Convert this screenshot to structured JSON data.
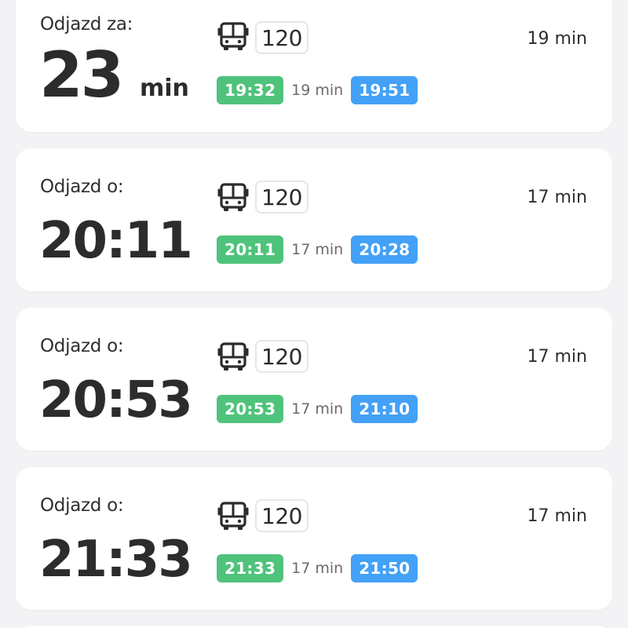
{
  "colors": {
    "departure_chip": "#4fc37b",
    "arrival_chip": "#43a1f7",
    "card_bg": "#ffffff",
    "page_bg": "#f3f3f5"
  },
  "departures": [
    {
      "label": "Odjazd za:",
      "countdown_value": "23",
      "countdown_unit": "min",
      "icon": "bus-icon",
      "route": "120",
      "duration": "19 min",
      "depart_time": "19:32",
      "trip_duration": "19 min",
      "arrive_time": "19:51"
    },
    {
      "label": "Odjazd o:",
      "time": "20:11",
      "icon": "bus-icon",
      "route": "120",
      "duration": "17 min",
      "depart_time": "20:11",
      "trip_duration": "17 min",
      "arrive_time": "20:28"
    },
    {
      "label": "Odjazd o:",
      "time": "20:53",
      "icon": "bus-icon",
      "route": "120",
      "duration": "17 min",
      "depart_time": "20:53",
      "trip_duration": "17 min",
      "arrive_time": "21:10"
    },
    {
      "label": "Odjazd o:",
      "time": "21:33",
      "icon": "bus-icon",
      "route": "120",
      "duration": "17 min",
      "depart_time": "21:33",
      "trip_duration": "17 min",
      "arrive_time": "21:50"
    }
  ]
}
